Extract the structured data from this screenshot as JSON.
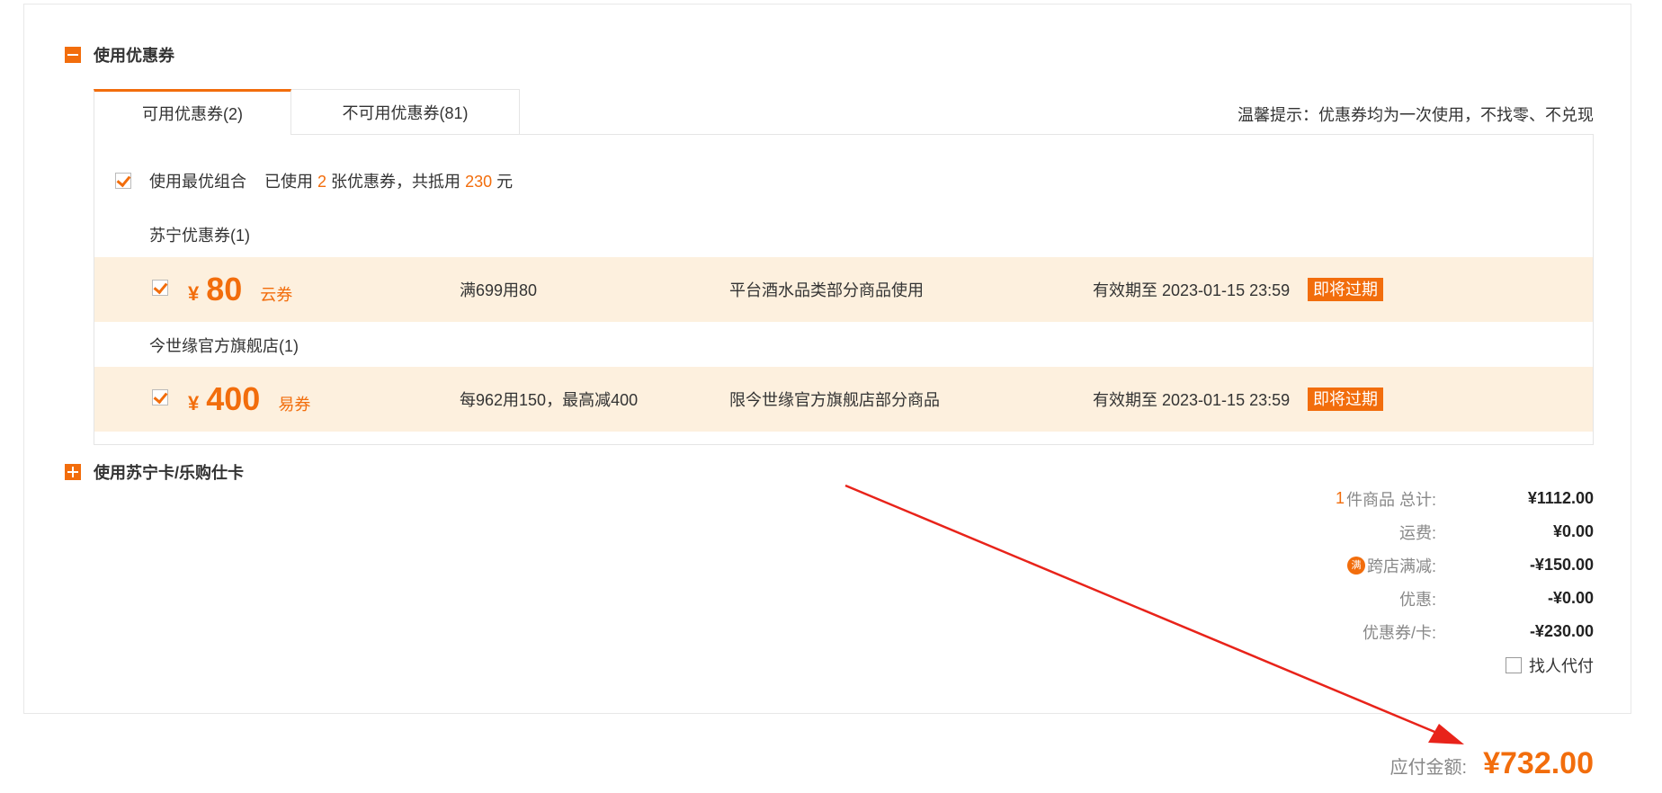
{
  "coupon_section": {
    "title": "使用优惠券",
    "tabs": [
      {
        "label": "可用优惠券(2)"
      },
      {
        "label": "不可用优惠券(81)"
      }
    ],
    "tip": "温馨提示：优惠券均为一次使用，不找零、不兑现",
    "best_combo": {
      "label": "使用最优组合",
      "used_prefix": "已使用",
      "used_count": "2",
      "used_mid": "张优惠券，共抵用",
      "discount": "230",
      "used_suffix": "元"
    },
    "groups": [
      {
        "title": "苏宁优惠券(1)",
        "coupon": {
          "currency": "¥",
          "amount": "80",
          "kind": "云券",
          "condition": "满699用80",
          "scope": "平台酒水品类部分商品使用",
          "validity": "有效期至 2023-01-15 23:59",
          "badge": "即将过期",
          "checked": true
        }
      },
      {
        "title": "今世缘官方旗舰店(1)",
        "coupon": {
          "currency": "¥",
          "amount": "400",
          "kind": "易券",
          "condition": "每962用150，最高减400",
          "scope": "限今世缘官方旗舰店部分商品",
          "validity": "有效期至 2023-01-15 23:59",
          "badge": "即将过期",
          "checked": true
        }
      }
    ]
  },
  "card_section": {
    "title": "使用苏宁卡/乐购仕卡"
  },
  "totals": {
    "items_count": "1",
    "items_label": "件商品 总计:",
    "items_value": "¥1112.00",
    "shipping_label": "运费:",
    "shipping_value": "¥0.00",
    "cross_icon": "满",
    "cross_label": "跨店满减:",
    "cross_value": "-¥150.00",
    "discount_label": "优惠:",
    "discount_value": "-¥0.00",
    "coupon_label": "优惠券/卡:",
    "coupon_value": "-¥230.00",
    "proxy_label": "找人代付"
  },
  "payable": {
    "label": "应付金额:",
    "value": "¥732.00"
  },
  "colors": {
    "accent": "#f26d0c",
    "row_bg": "#fdf0de",
    "arrow": "#e8231a"
  }
}
